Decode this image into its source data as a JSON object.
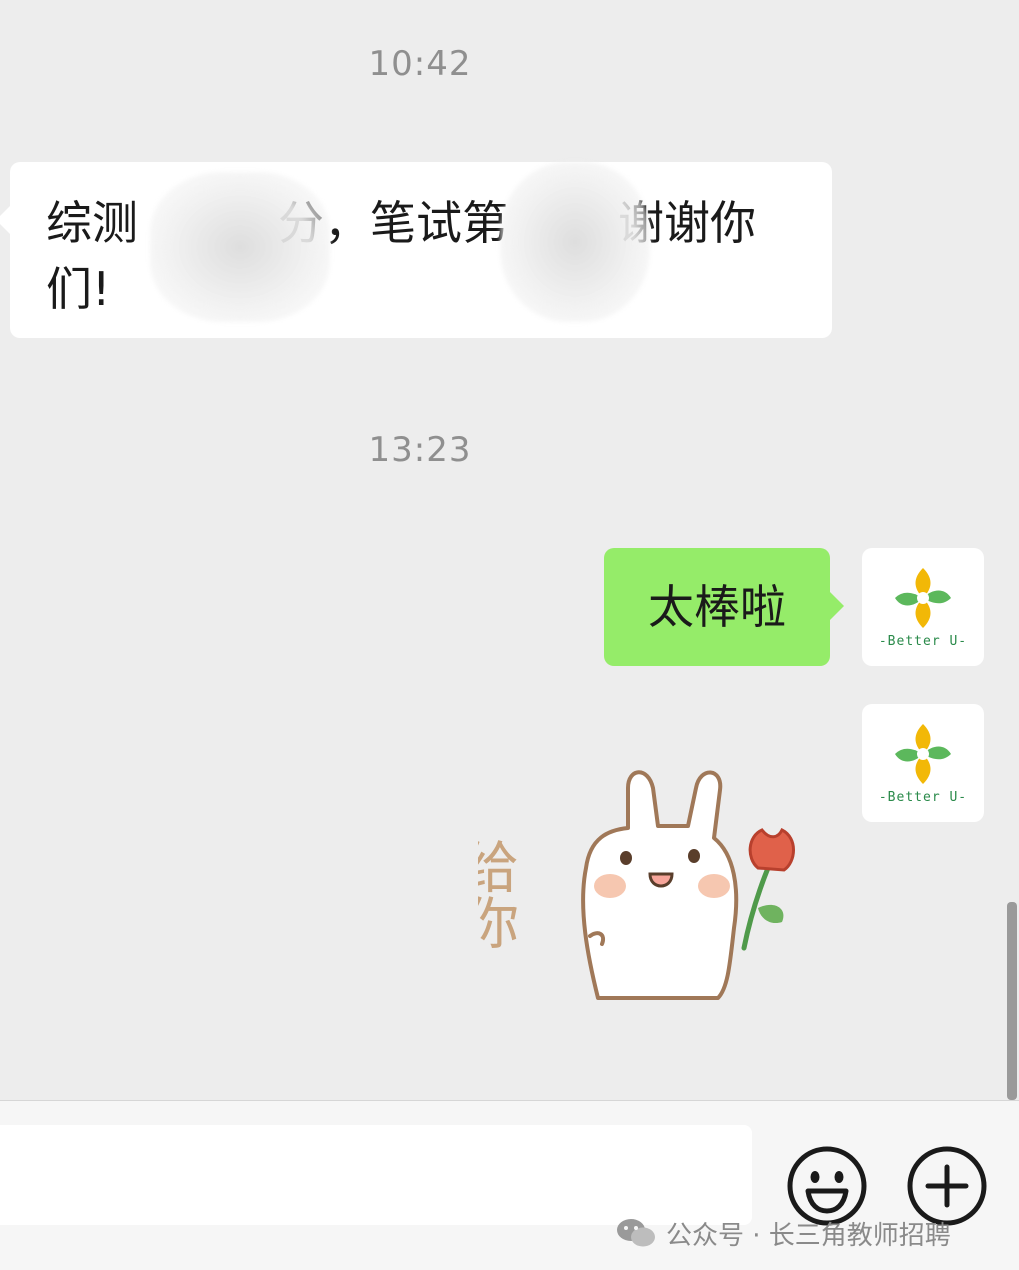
{
  "chat": {
    "timestamps": [
      "10:42",
      "13:23"
    ],
    "messages": [
      {
        "sender": "other",
        "type": "text",
        "text": "综测 分，笔试第 谢谢你们!",
        "line1_a": "综测",
        "line1_b": "分，笔试第",
        "line1_c": "谢谢你",
        "line2": "们!"
      },
      {
        "sender": "self",
        "type": "text",
        "text": "太棒啦"
      },
      {
        "sender": "self",
        "type": "sticker",
        "sticker_text": "给你"
      }
    ]
  },
  "avatar": {
    "caption": "-Better U-",
    "icon": "better-u-logo"
  },
  "input_bar": {
    "placeholder": "",
    "emoji_icon": "smiley-icon",
    "plus_icon": "plus-icon"
  },
  "watermark": {
    "text": "公众号 · 长三角教师招聘"
  },
  "colors": {
    "background": "#ededed",
    "self_bubble": "#95ec69",
    "other_bubble": "#ffffff",
    "timestamp": "#8f8f8f"
  }
}
